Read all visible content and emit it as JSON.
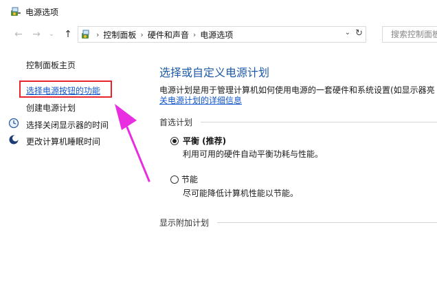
{
  "window": {
    "title": "电源选项",
    "icon": "power-options-icon"
  },
  "nav": {
    "back_icon": "←",
    "forward_icon": "→",
    "recent_icon": "⌄",
    "up_icon": "↑"
  },
  "address": {
    "crumbs": [
      "控制面板",
      "硬件和声音",
      "电源选项"
    ],
    "separator": "›",
    "dropdown_icon": "⌄",
    "refresh_icon": "↻"
  },
  "search": {
    "placeholder": "搜索控制面板"
  },
  "sidebar": {
    "home": "控制面板主页",
    "items": [
      {
        "label": "选择电源按钮的功能",
        "style": "link",
        "icon": ""
      },
      {
        "label": "创建电源计划",
        "style": "plain",
        "icon": ""
      },
      {
        "label": "选择关闭显示器的时间",
        "style": "plain",
        "icon": "monitor-clock-icon"
      },
      {
        "label": "更改计算机睡眠时间",
        "style": "plain",
        "icon": "moon-sleep-icon"
      }
    ]
  },
  "main": {
    "heading": "选择或自定义电源计划",
    "description": "电源计划是用于管理计算机如何使用电源的一套硬件和系统设置(如显示器亮",
    "details_link": "关电源计划的详细信息",
    "preferred_group": "首选计划",
    "plans": [
      {
        "name": "平衡 (推荐)",
        "desc": "利用可用的硬件自动平衡功耗与性能。",
        "selected": true
      },
      {
        "name": "节能",
        "desc": "尽可能降低计算机性能以节能。",
        "selected": false
      }
    ],
    "additional_group": "显示附加计划"
  },
  "colors": {
    "heading": "#1d5aa8",
    "link": "#1155cc",
    "highlight_box": "#e8232a",
    "annotation_arrow": "#e82ee0"
  }
}
